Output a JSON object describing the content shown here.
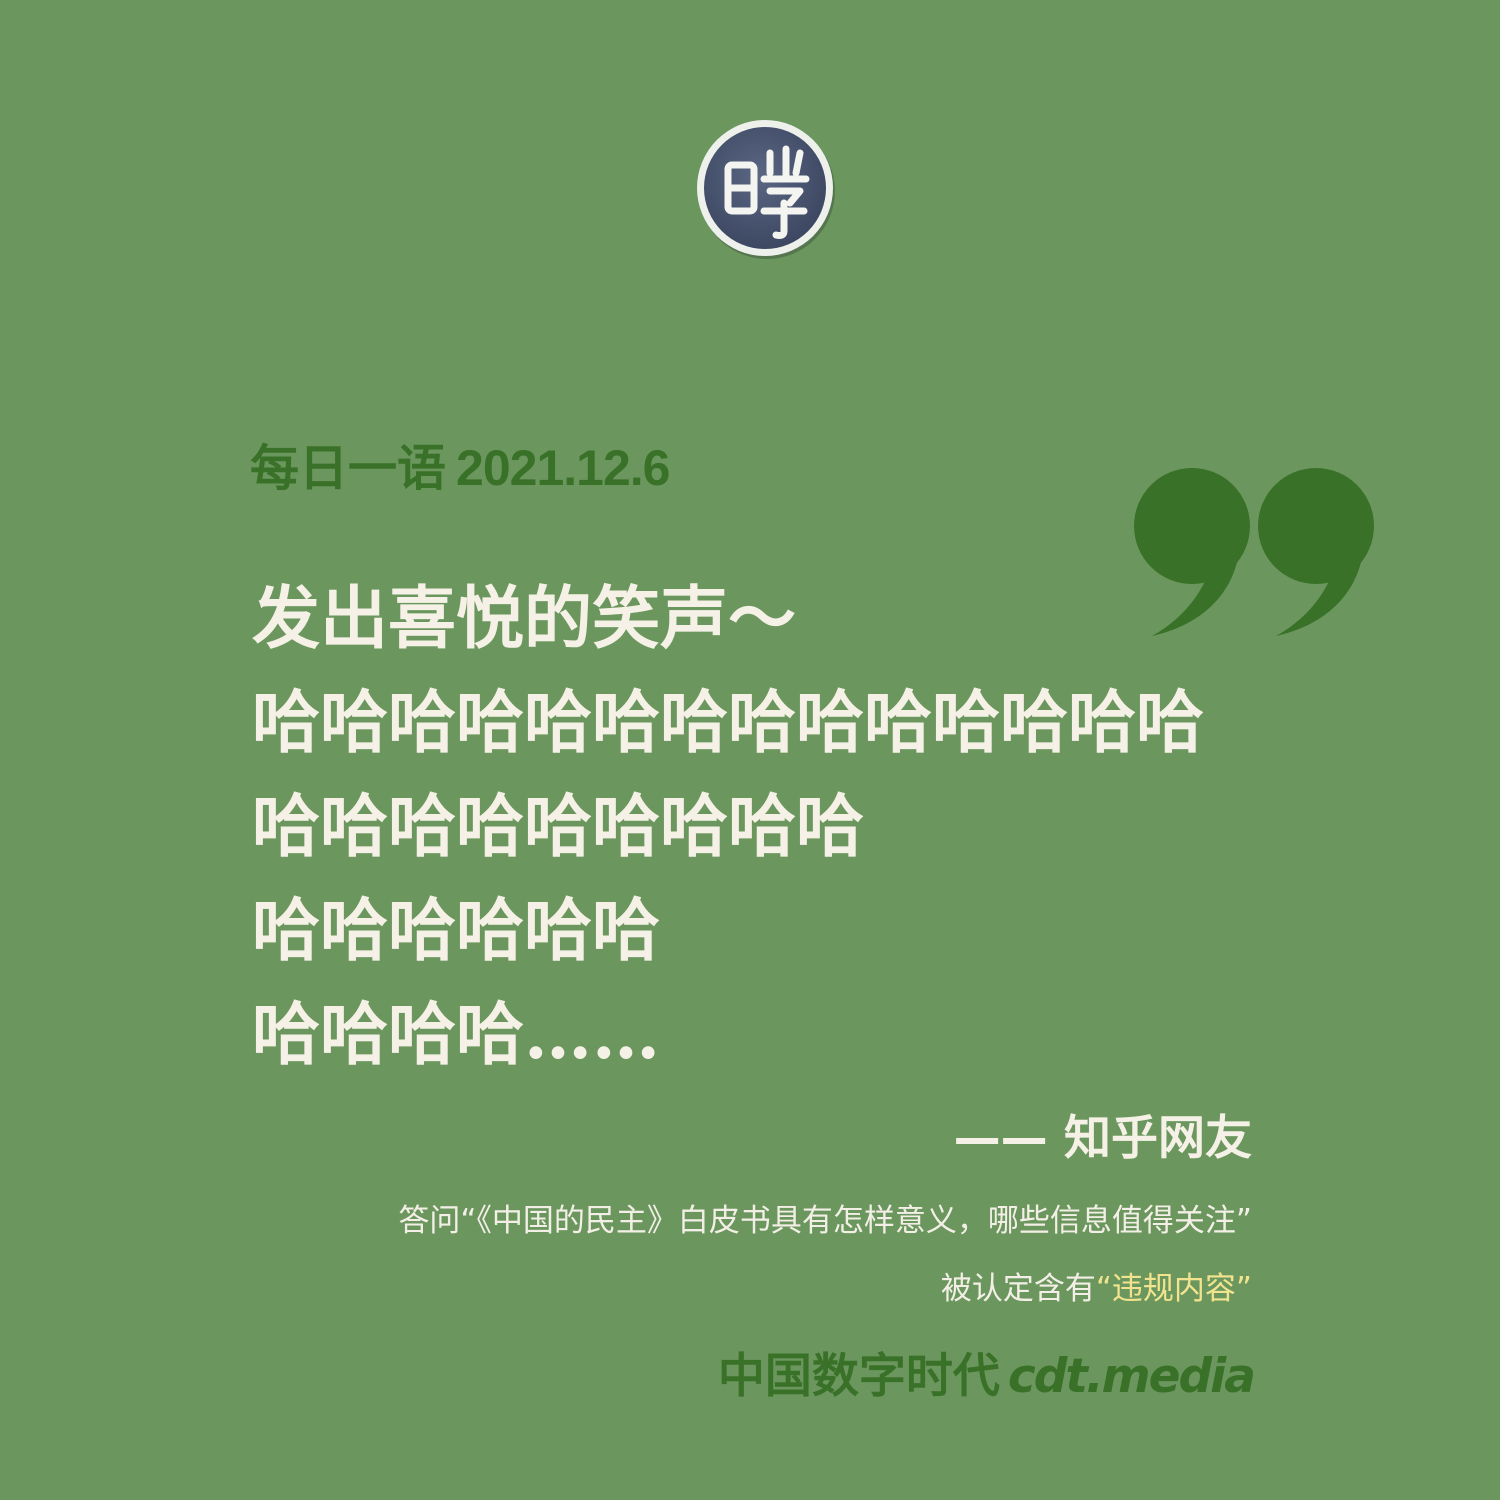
{
  "logo": {
    "glyph": "瞪",
    "icon": "seal-logo-icon"
  },
  "heading": {
    "label": "每日一语",
    "date": "2021.12.6"
  },
  "quote": {
    "lines": [
      "发出喜悦的笑声～",
      "哈哈哈哈哈哈哈哈哈哈哈哈哈哈",
      "哈哈哈哈哈哈哈哈哈",
      "哈哈哈哈哈哈",
      "哈哈哈哈……"
    ]
  },
  "author": "—— 知乎网友",
  "caption": {
    "line1": "答问“《中国的民主》白皮书具有怎样意义，哪些信息值得关注”",
    "line2_prefix": "被认定含有",
    "line2_highlight": "“违规内容”"
  },
  "brand": {
    "cn": "中国数字时代",
    "en": "cdt.media"
  },
  "colors": {
    "background": "#6b975f",
    "accent_green": "#3a7128",
    "text_light": "#f6f1e6",
    "highlight_yellow": "#f2e48e",
    "logo_fill": "#485470"
  }
}
